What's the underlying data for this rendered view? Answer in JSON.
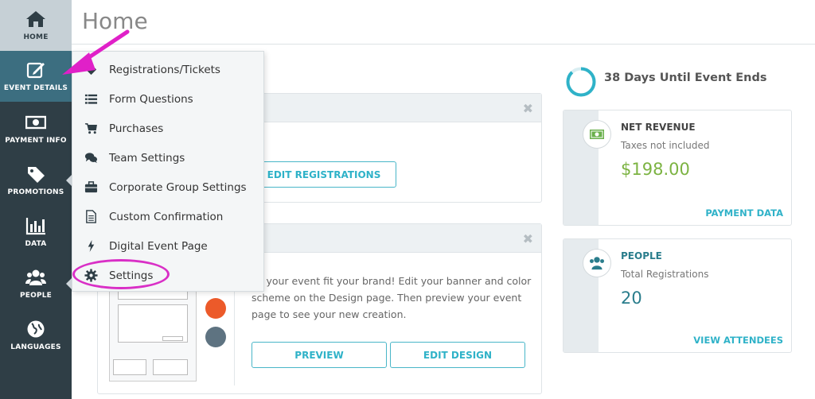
{
  "sidebar": {
    "items": [
      {
        "label": "HOME",
        "icon": "home-icon"
      },
      {
        "label": "EVENT DETAILS",
        "icon": "edit-icon"
      },
      {
        "label": "PAYMENT INFO",
        "icon": "money-icon"
      },
      {
        "label": "PROMOTIONS",
        "icon": "tag-icon"
      },
      {
        "label": "DATA",
        "icon": "bar-chart-icon"
      },
      {
        "label": "PEOPLE",
        "icon": "people-icon"
      },
      {
        "label": "LANGUAGES",
        "icon": "globe-icon"
      }
    ]
  },
  "header": {
    "title": "Home"
  },
  "dropdown": {
    "items": [
      {
        "label": "Registrations/Tickets",
        "icon": "tag-icon"
      },
      {
        "label": "Form Questions",
        "icon": "list-icon"
      },
      {
        "label": "Purchases",
        "icon": "cart-icon"
      },
      {
        "label": "Team Settings",
        "icon": "chat-icon"
      },
      {
        "label": "Corporate Group Settings",
        "icon": "briefcase-icon"
      },
      {
        "label": "Custom Confirmation",
        "icon": "document-icon"
      },
      {
        "label": "Digital Event Page",
        "icon": "lightning-icon"
      },
      {
        "label": "Settings",
        "icon": "gear-icon"
      }
    ]
  },
  "registrations_card": {
    "button_label": "EDIT REGISTRATIONS"
  },
  "design_card": {
    "text": "ke your event fit your brand! Edit your banner and color scheme on the Design page. Then preview your event page to see your new creation.",
    "preview_label": "PREVIEW",
    "edit_design_label": "EDIT DESIGN",
    "colors": {
      "orange": "#ec5a2a",
      "slate": "#5e7381"
    }
  },
  "countdown": {
    "text": "38 Days Until Event Ends",
    "progress_percent": 88
  },
  "revenue": {
    "title": "NET REVENUE",
    "subtitle": "Taxes not included",
    "value": "$198.00",
    "link": "PAYMENT DATA"
  },
  "people": {
    "title": "PEOPLE",
    "subtitle": "Total Registrations",
    "value": "20",
    "link": "VIEW ATTENDEES"
  },
  "colors": {
    "sidebar": "#2f3e46",
    "accent": "#2fb2c8",
    "annotation": "#d92fc6",
    "revenue": "#7cb342"
  }
}
